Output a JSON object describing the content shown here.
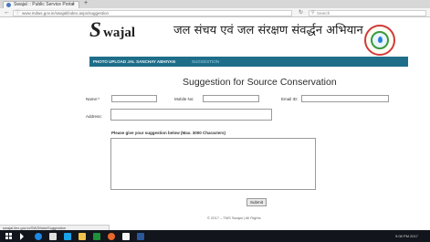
{
  "browser": {
    "tab_title": "Swajal :: Public Service Portal",
    "tab_close": "×",
    "new_tab": "+",
    "url": "www.mdws.gov.in/swajal/index.aspx/suggestion",
    "search_placeholder": "Search"
  },
  "site": {
    "logo_letter": "S",
    "logo_rest": "wajal",
    "hindi_title": "जल संचय एवं जल संरक्षण संवर्द्धन अभियान",
    "nav": [
      {
        "label": "PHOTO UPLOAD JAL SANCHAY ABHIYAN"
      },
      {
        "label": "SUGGESTION"
      }
    ]
  },
  "form": {
    "title": "Suggestion for Source Conservation",
    "name_label": "Name:*",
    "mobile_label": "Mobile No:",
    "email_label": "Email ID:",
    "address_label": "Address:",
    "suggestion_label": "Please give your suggestion below (Max. 3000 Characters)",
    "submit_label": "Submit"
  },
  "footer": {
    "text": "© 2017 – TMS Swajal | All Rights"
  },
  "status": {
    "text": "swajal.ilex.gov.in/SWJMain/Suggestion"
  },
  "taskbar": {
    "clock": "9:08 PM 2017"
  },
  "colors": {
    "nav_bar": "#1e6e8a",
    "taskbar": "#12151c"
  }
}
